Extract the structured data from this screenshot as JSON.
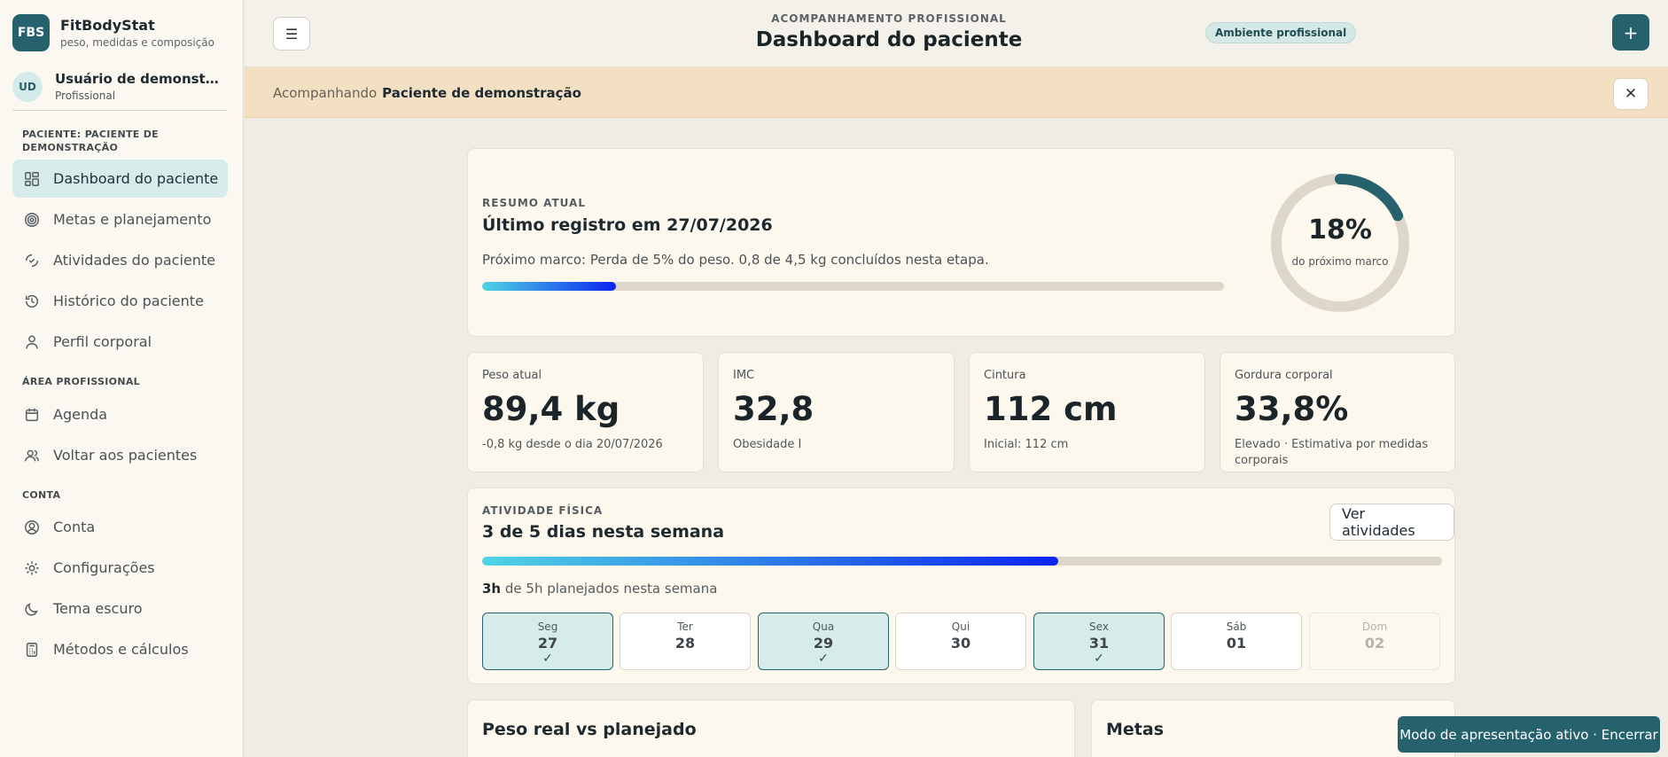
{
  "brand": {
    "logo": "FBS",
    "name": "FitBodyStat",
    "subtitle": "peso, medidas e composição"
  },
  "user": {
    "initials": "UD",
    "name": "Usuário de demonstração",
    "role": "Profissional"
  },
  "sidebar": {
    "patient_section": "Paciente: Paciente de demonstração",
    "patient_items": [
      {
        "label": "Dashboard do paciente",
        "icon": "dashboard-icon",
        "active": true
      },
      {
        "label": "Metas e planejamento",
        "icon": "target-icon"
      },
      {
        "label": "Atividades do paciente",
        "icon": "activity-icon"
      },
      {
        "label": "Histórico do paciente",
        "icon": "history-icon"
      },
      {
        "label": "Perfil corporal",
        "icon": "person-icon"
      }
    ],
    "pro_section": "Área profissional",
    "pro_items": [
      {
        "label": "Agenda",
        "icon": "calendar-icon"
      },
      {
        "label": "Voltar aos pacientes",
        "icon": "users-icon"
      }
    ],
    "account_section": "Conta",
    "account_items": [
      {
        "label": "Conta",
        "icon": "user-circle-icon"
      },
      {
        "label": "Configurações",
        "icon": "gear-icon"
      },
      {
        "label": "Tema escuro",
        "icon": "moon-icon"
      },
      {
        "label": "Métodos e cálculos",
        "icon": "calculator-icon"
      }
    ]
  },
  "header": {
    "menu": "☰",
    "kicker": "ACOMPANHAMENTO PROFISSIONAL",
    "title": "Dashboard do paciente",
    "badge": "Ambiente profissional",
    "add": "+"
  },
  "banner": {
    "prefix": "Acompanhando",
    "patient": "Paciente de demonstração",
    "close": "✕"
  },
  "summary": {
    "eyebrow": "RESUMO ATUAL",
    "title": "Último registro em 27/07/2026",
    "milestone": "Próximo marco: Perda de 5% do peso. 0,8 de 4,5 kg concluídos nesta etapa.",
    "progress": 0.18,
    "ring_value": "18%",
    "ring_label": "do próximo marco",
    "colors": {
      "ring": "#25626d",
      "track": "#ddd6ca"
    }
  },
  "metrics": [
    {
      "label": "Peso atual",
      "value": "89,4 kg",
      "sub": "-0,8 kg desde o dia 20/07/2026"
    },
    {
      "label": "IMC",
      "value": "32,8",
      "sub": "Obesidade I"
    },
    {
      "label": "Cintura",
      "value": "112 cm",
      "sub": "Inicial: 112 cm"
    },
    {
      "label": "Gordura corporal",
      "value": "33,8%",
      "sub": "Elevado · Estimativa por medidas corporais"
    }
  ],
  "activity": {
    "eyebrow": "ATIVIDADE FÍSICA",
    "title": "3 de 5 dias nesta semana",
    "button": "Ver atividades",
    "progress": 0.6,
    "hours_bold": "3h",
    "hours_rest": " de 5h planejados nesta semana",
    "days": [
      {
        "name": "Seg",
        "date": "27",
        "done": true,
        "check": "✓"
      },
      {
        "name": "Ter",
        "date": "28",
        "done": false,
        "check": ""
      },
      {
        "name": "Qua",
        "date": "29",
        "done": true,
        "check": "✓"
      },
      {
        "name": "Qui",
        "date": "30",
        "done": false,
        "check": ""
      },
      {
        "name": "Sex",
        "date": "31",
        "done": true,
        "check": "✓"
      },
      {
        "name": "Sáb",
        "date": "01",
        "done": false,
        "check": ""
      },
      {
        "name": "Dom",
        "date": "02",
        "done": false,
        "check": "",
        "muted": true
      }
    ]
  },
  "bottom": {
    "weight_title": "Peso real vs planejado",
    "goals_title": "Metas"
  },
  "toast": "Modo de apresentação ativo · Encerrar"
}
